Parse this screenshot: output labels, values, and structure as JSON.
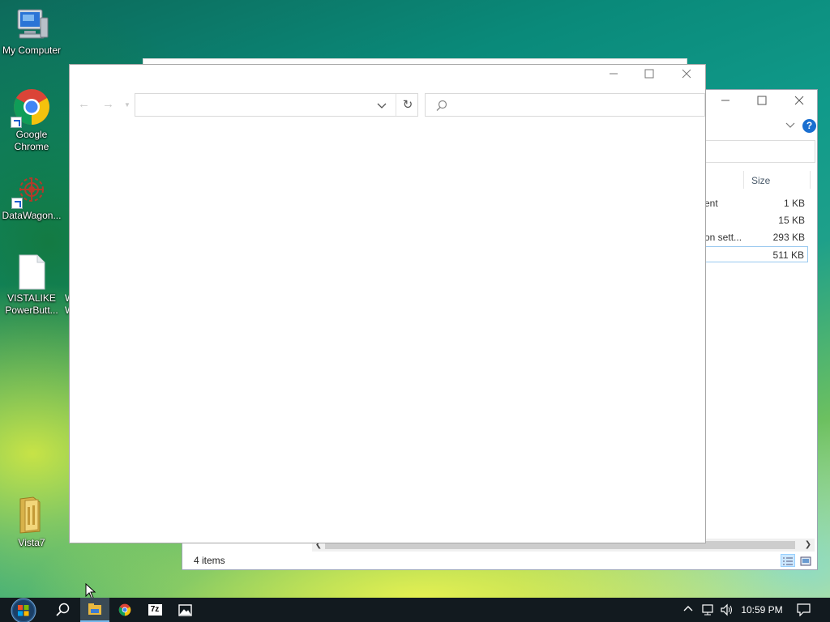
{
  "desktop": {
    "icons": [
      {
        "label": "My Computer"
      },
      {
        "label": "Google Chrome"
      },
      {
        "label": "DataWagon..."
      },
      {
        "label": "VISTALIKE PowerButt..."
      },
      {
        "label": "Vista7"
      }
    ],
    "partial_icon_label": "W W"
  },
  "back_window": {
    "column_size": "Size",
    "files": [
      {
        "type": "ent",
        "size": "1 KB"
      },
      {
        "type": "",
        "size": "15 KB"
      },
      {
        "type": "on sett...",
        "size": "293 KB"
      },
      {
        "type": "",
        "size": "511 KB",
        "selected": true
      }
    ],
    "status": "4 items",
    "help_icon_label": "?"
  },
  "front_window": {
    "address_value": "",
    "search_placeholder": ""
  },
  "taskbar": {
    "clock": "10:59 PM",
    "apps": [
      "start-orb",
      "search",
      "file-explorer",
      "google-chrome",
      "7-zip",
      "photos"
    ]
  },
  "colors": {
    "taskbar": "#121a1f",
    "accent": "#76b9ed",
    "selection": "#cce8ff"
  }
}
